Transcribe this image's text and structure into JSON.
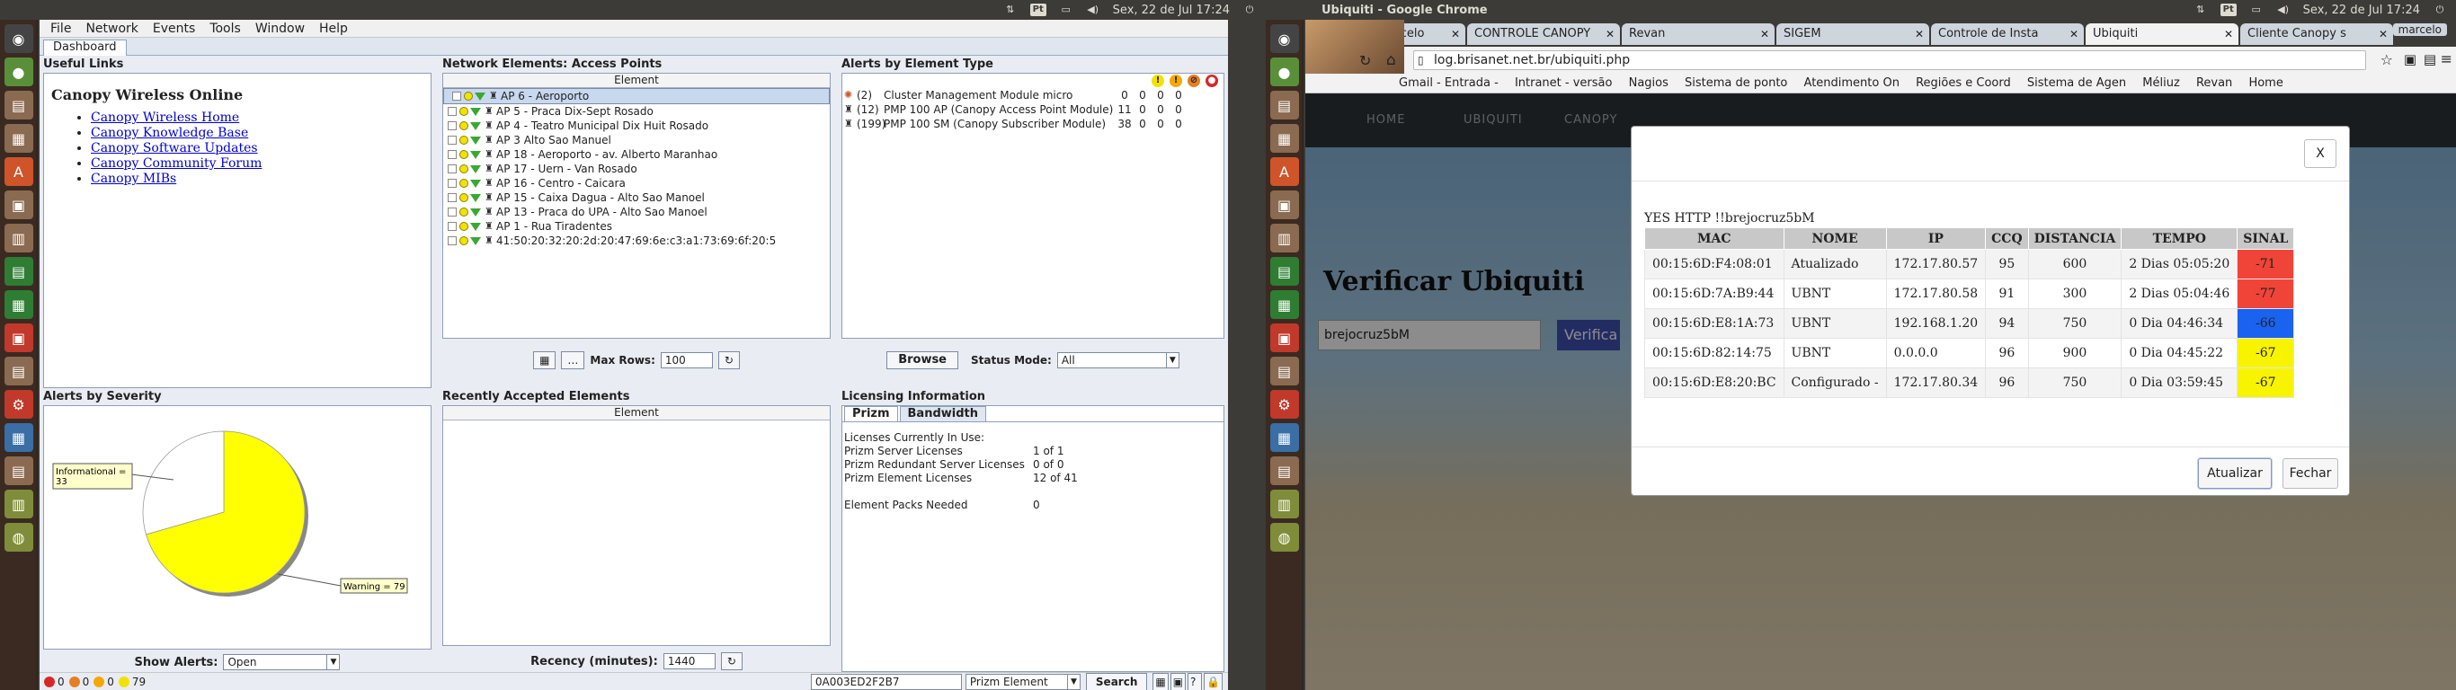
{
  "left_screen": {
    "topbar_tray": {
      "lang": "Pt",
      "clock": "Sex, 22 de Jul 17:24"
    },
    "menubar": [
      "File",
      "Network",
      "Events",
      "Tools",
      "Window",
      "Help"
    ],
    "tab": "Dashboard",
    "useful_links": {
      "title": "Useful Links",
      "heading": "Canopy Wireless Online",
      "links": [
        "Canopy Wireless Home",
        "Canopy Knowledge Base",
        "Canopy Software Updates",
        "Canopy Community Forum",
        "Canopy MIBs"
      ]
    },
    "access_points": {
      "title": "Network Elements: Access Points",
      "column": "Element",
      "rows": [
        "AP 6 - Aeroporto",
        "AP 5 - Praca Dix-Sept Rosado",
        "AP 4 - Teatro Municipal Dix Huit Rosado",
        "AP 3 Alto Sao Manuel",
        "AP 18 - Aeroporto - av. Alberto Maranhao",
        "AP 17 - Uern - Van Rosado",
        "AP 16 - Centro - Caicara",
        "AP 15 - Caixa Dagua - Alto Sao Manoel",
        "AP 13 - Praca do UPA - Alto Sao Manoel",
        "AP 1 - Rua Tiradentes",
        "41:50:20:32:20:2d:20:47:69:6e:c3:a1:73:69:6f:20:5"
      ],
      "max_rows_label": "Max Rows:",
      "max_rows_value": "100"
    },
    "alerts_by_type": {
      "title": "Alerts by Element Type",
      "rows": [
        {
          "count": "(2)",
          "name": "Cluster Management Module micro",
          "v": [
            "0",
            "0",
            "0",
            "0"
          ]
        },
        {
          "count": "(12)",
          "name": "PMP 100 AP (Canopy Access Point Module)",
          "v": [
            "11",
            "0",
            "0",
            "0"
          ]
        },
        {
          "count": "(199)",
          "name": "PMP 100 SM (Canopy Subscriber Module)",
          "v": [
            "38",
            "0",
            "0",
            "0"
          ]
        }
      ],
      "browse": "Browse",
      "status_mode_label": "Status Mode:",
      "status_mode_value": "All"
    },
    "alerts_by_severity": {
      "title": "Alerts by Severity",
      "slices": [
        {
          "label": "Informational = 33",
          "value": 33,
          "color": "#ffffff"
        },
        {
          "label": "Warning = 79",
          "value": 79,
          "color": "#ffff00"
        }
      ],
      "label_info_1": "Informational =",
      "label_info_2": "33",
      "label_warn": "Warning = 79",
      "show_alerts_label": "Show Alerts:",
      "show_alerts_value": "Open"
    },
    "recent": {
      "title": "Recently Accepted Elements",
      "column": "Element",
      "recency_label": "Recency (minutes):",
      "recency_value": "1440"
    },
    "licensing": {
      "title": "Licensing Information",
      "tabs": [
        "Prizm",
        "Bandwidth"
      ],
      "lines": [
        {
          "k": "Licenses Currently In Use:",
          "v": ""
        },
        {
          "k": "Prizm Server Licenses",
          "v": "1 of 1"
        },
        {
          "k": "Prizm Redundant Server Licenses",
          "v": "0 of 0"
        },
        {
          "k": "Prizm Element Licenses",
          "v": "12 of 41"
        },
        {
          "k": "",
          "v": ""
        },
        {
          "k": "Element Packs Needed",
          "v": "0"
        }
      ]
    },
    "statusbar": {
      "c1": "0",
      "c2": "0",
      "c3": "0",
      "c4": "79",
      "search_value": "0A003ED2F2B7",
      "search_type": "Prizm Element",
      "search_btn": "Search"
    }
  },
  "right_screen": {
    "window_title": "Ubiquiti - Google Chrome",
    "tray": {
      "lang": "Pt",
      "clock": "Sex, 22 de Jul 17:24",
      "user": "marcelo"
    },
    "tabs": [
      "Entrada - marcelo",
      "CONTROLE CANOPY",
      "Revan",
      "SIGEM",
      "Controle de Insta",
      "Ubiquiti",
      "Cliente Canopy s"
    ],
    "url": "log.brisanet.net.br/ubiquiti.php",
    "bookmarks": [
      "Gmail - Entrada -",
      "Intranet - versão",
      "Nagios",
      "Sistema de ponto",
      "Atendimento On",
      "Regiões e Coord",
      "Sistema de Agen",
      "Méliuz",
      "Revan",
      "Home"
    ],
    "nav": [
      "HOME",
      "UBIQUITI",
      "CANOPY"
    ],
    "page_title": "Verificar Ubiquiti",
    "input_value": "brejocruz5bM",
    "verify_btn": "Verifica",
    "modal": {
      "close": "X",
      "heading": "YES HTTP !!brejocruz5bM",
      "columns": [
        "MAC",
        "NOME",
        "IP",
        "CCQ",
        "DISTANCIA",
        "TEMPO",
        "SINAL"
      ],
      "rows": [
        {
          "mac": "00:15:6D:F4:08:01",
          "nome": "Atualizado",
          "ip": "172.17.80.57",
          "ccq": "95",
          "dist": "600",
          "tempo": "2 Dias 05:05:20",
          "sinal": "-71",
          "color": "#f04438"
        },
        {
          "mac": "00:15:6D:7A:B9:44",
          "nome": "UBNT",
          "ip": "172.17.80.58",
          "ccq": "91",
          "dist": "300",
          "tempo": "2 Dias 05:04:46",
          "sinal": "-77",
          "color": "#f04438"
        },
        {
          "mac": "00:15:6D:E8:1A:73",
          "nome": "UBNT",
          "ip": "192.168.1.20",
          "ccq": "94",
          "dist": "750",
          "tempo": "0 Dia 04:46:34",
          "sinal": "-66",
          "color": "#1a62f0"
        },
        {
          "mac": "00:15:6D:82:14:75",
          "nome": "UBNT",
          "ip": "0.0.0.0",
          "ccq": "96",
          "dist": "900",
          "tempo": "0 Dia 04:45:22",
          "sinal": "-67",
          "color": "#f8f400"
        },
        {
          "mac": "00:15:6D:E8:20:BC",
          "nome": "Configurado -",
          "ip": "172.17.80.34",
          "ccq": "96",
          "dist": "750",
          "tempo": "0 Dia 03:59:45",
          "sinal": "-67",
          "color": "#f8f400"
        }
      ],
      "btn_update": "Atualizar",
      "btn_close": "Fechar"
    }
  }
}
